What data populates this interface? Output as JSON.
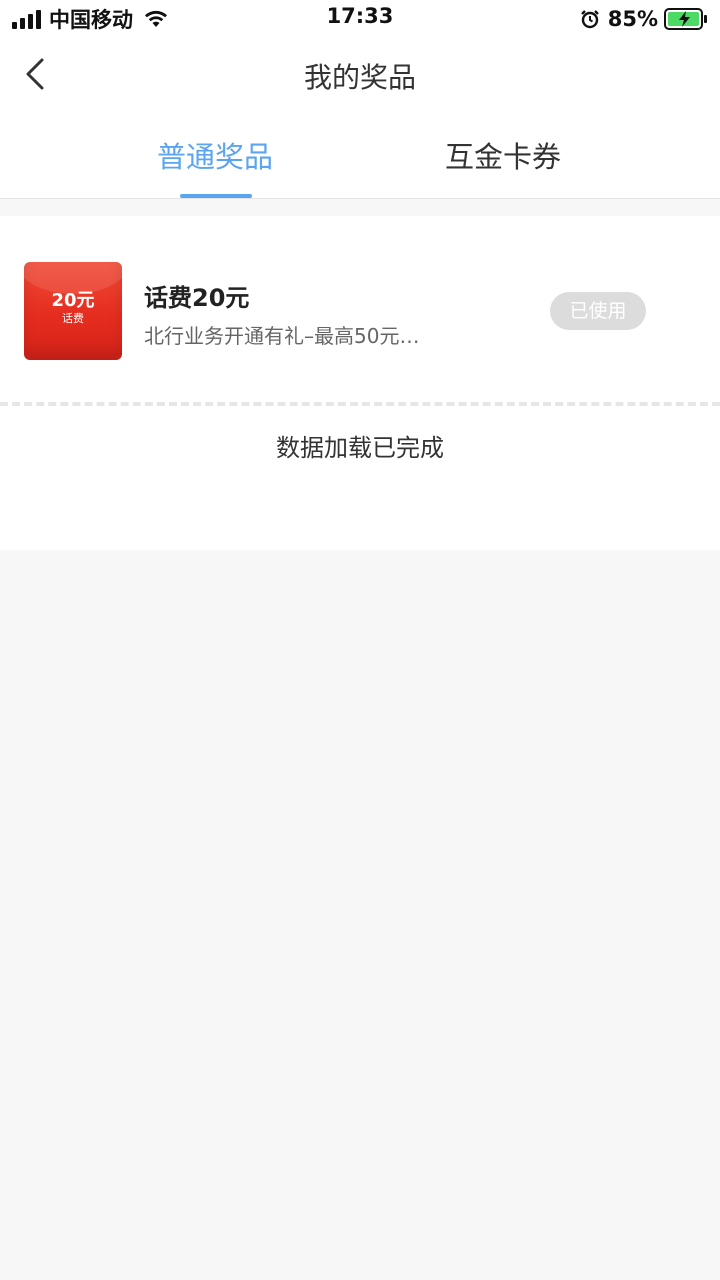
{
  "status_bar": {
    "carrier": "中国移动",
    "time": "17:33",
    "battery": "85%",
    "icons": [
      "signal-icon",
      "wifi-icon",
      "alarm-icon",
      "battery-charging-icon"
    ]
  },
  "nav": {
    "title": "我的奖品",
    "back_icon": "chevron-left-icon"
  },
  "tabs": [
    {
      "label": "普通奖品",
      "active": true
    },
    {
      "label": "互金卡券",
      "active": false
    }
  ],
  "prizes": [
    {
      "image_amount": "20元",
      "image_type": "话费",
      "name": "话费20元",
      "description": "北行业务开通有礼–最高50元…",
      "status": "已使用"
    }
  ],
  "list_footer": "数据加载已完成",
  "colors": {
    "accent": "#5ba4f0",
    "badge_bg": "#dcdcdc",
    "prize_red": "#e52d1f",
    "page_bg": "#f7f7f7"
  }
}
